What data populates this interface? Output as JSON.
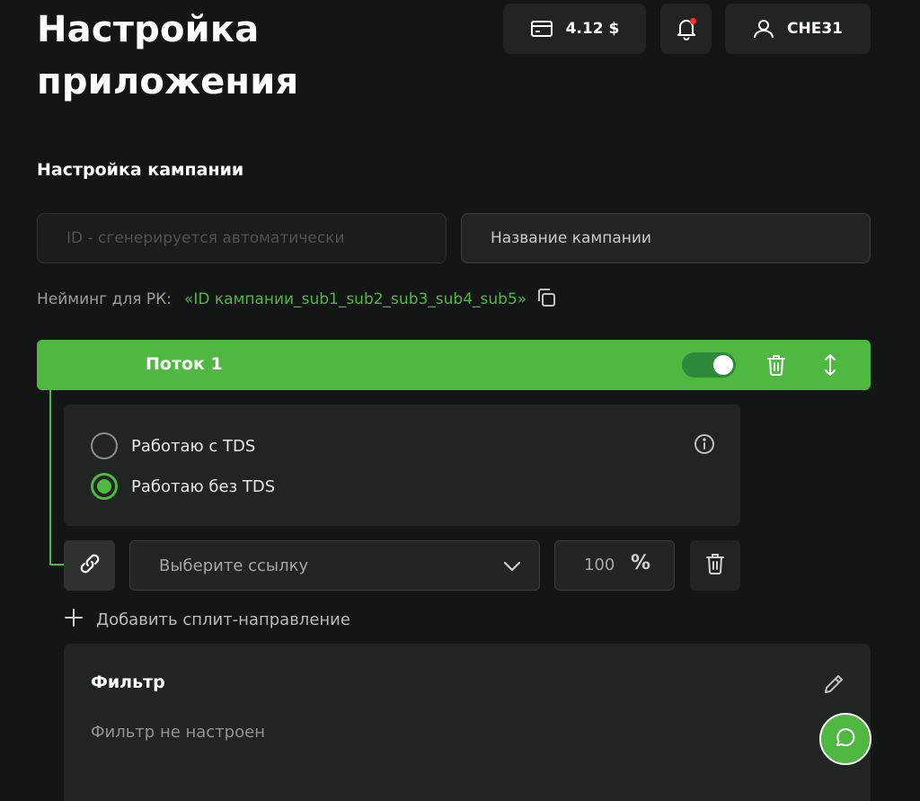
{
  "page": {
    "title": "Настройка приложения"
  },
  "header": {
    "balance": "4.12 $",
    "username": "CHE31",
    "notifications_unread": true,
    "icons": [
      "card-icon",
      "bell-icon",
      "user-icon"
    ]
  },
  "campaign": {
    "section_title": "Настройка кампании",
    "id_placeholder": "ID - сгенерируется автоматически",
    "name_placeholder": "Название кампании",
    "naming_label": "Нейминг для РК:",
    "naming_value": "«ID кампании_sub1_sub2_sub3_sub4_sub5»"
  },
  "stream": {
    "title": "Поток 1",
    "enabled": true,
    "options": [
      {
        "label": "Работаю с TDS",
        "selected": false
      },
      {
        "label": "Работаю без TDS",
        "selected": true
      }
    ],
    "link_placeholder": "Выберите ссылку",
    "percent_value": "100",
    "percent_sign": "%",
    "add_split_label": "Добавить сплит-направление"
  },
  "filter": {
    "title": "Фильтр",
    "status": "Фильтр не настроен"
  },
  "colors": {
    "accent": "#4fb840",
    "background": "#141515",
    "card": "#202423",
    "notification_dot": "#ff2d2d"
  }
}
